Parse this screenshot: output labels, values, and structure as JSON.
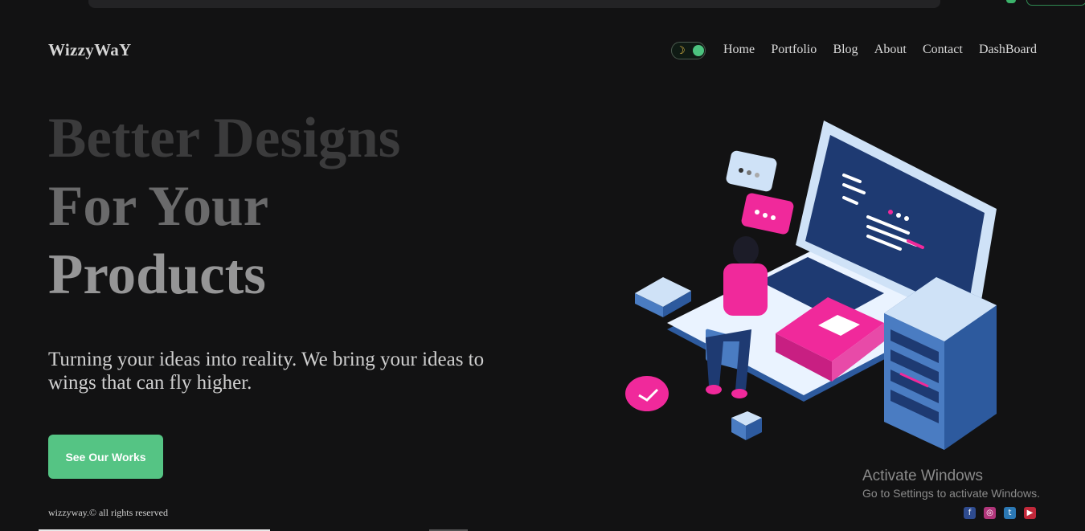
{
  "header": {
    "brand": "WizzyWaY",
    "nav": [
      "Home",
      "Portfolio",
      "Blog",
      "About",
      "Contact",
      "DashBoard"
    ]
  },
  "theme_toggle": {
    "icon": "moon-icon",
    "knob_color": "#4cc37f"
  },
  "hero": {
    "title_lines": [
      "Better Designs",
      "For Your",
      "Products"
    ],
    "tagline": "Turning your ideas into reality. We bring your ideas to wings that can fly higher.",
    "cta_label": "See Our Works"
  },
  "footer": {
    "copyright": "wizzyway.© all rights reserved",
    "social_icons": [
      "facebook-icon",
      "instagram-icon",
      "twitter-icon",
      "youtube-icon"
    ]
  },
  "watermark": {
    "title": "Activate Windows",
    "subtitle": "Go to Settings to activate Windows."
  },
  "colors": {
    "background": "#121213",
    "accent": "#55c484",
    "pink": "#f0299b",
    "navy": "#1e3a72",
    "light_blue": "#cfe2f7"
  }
}
